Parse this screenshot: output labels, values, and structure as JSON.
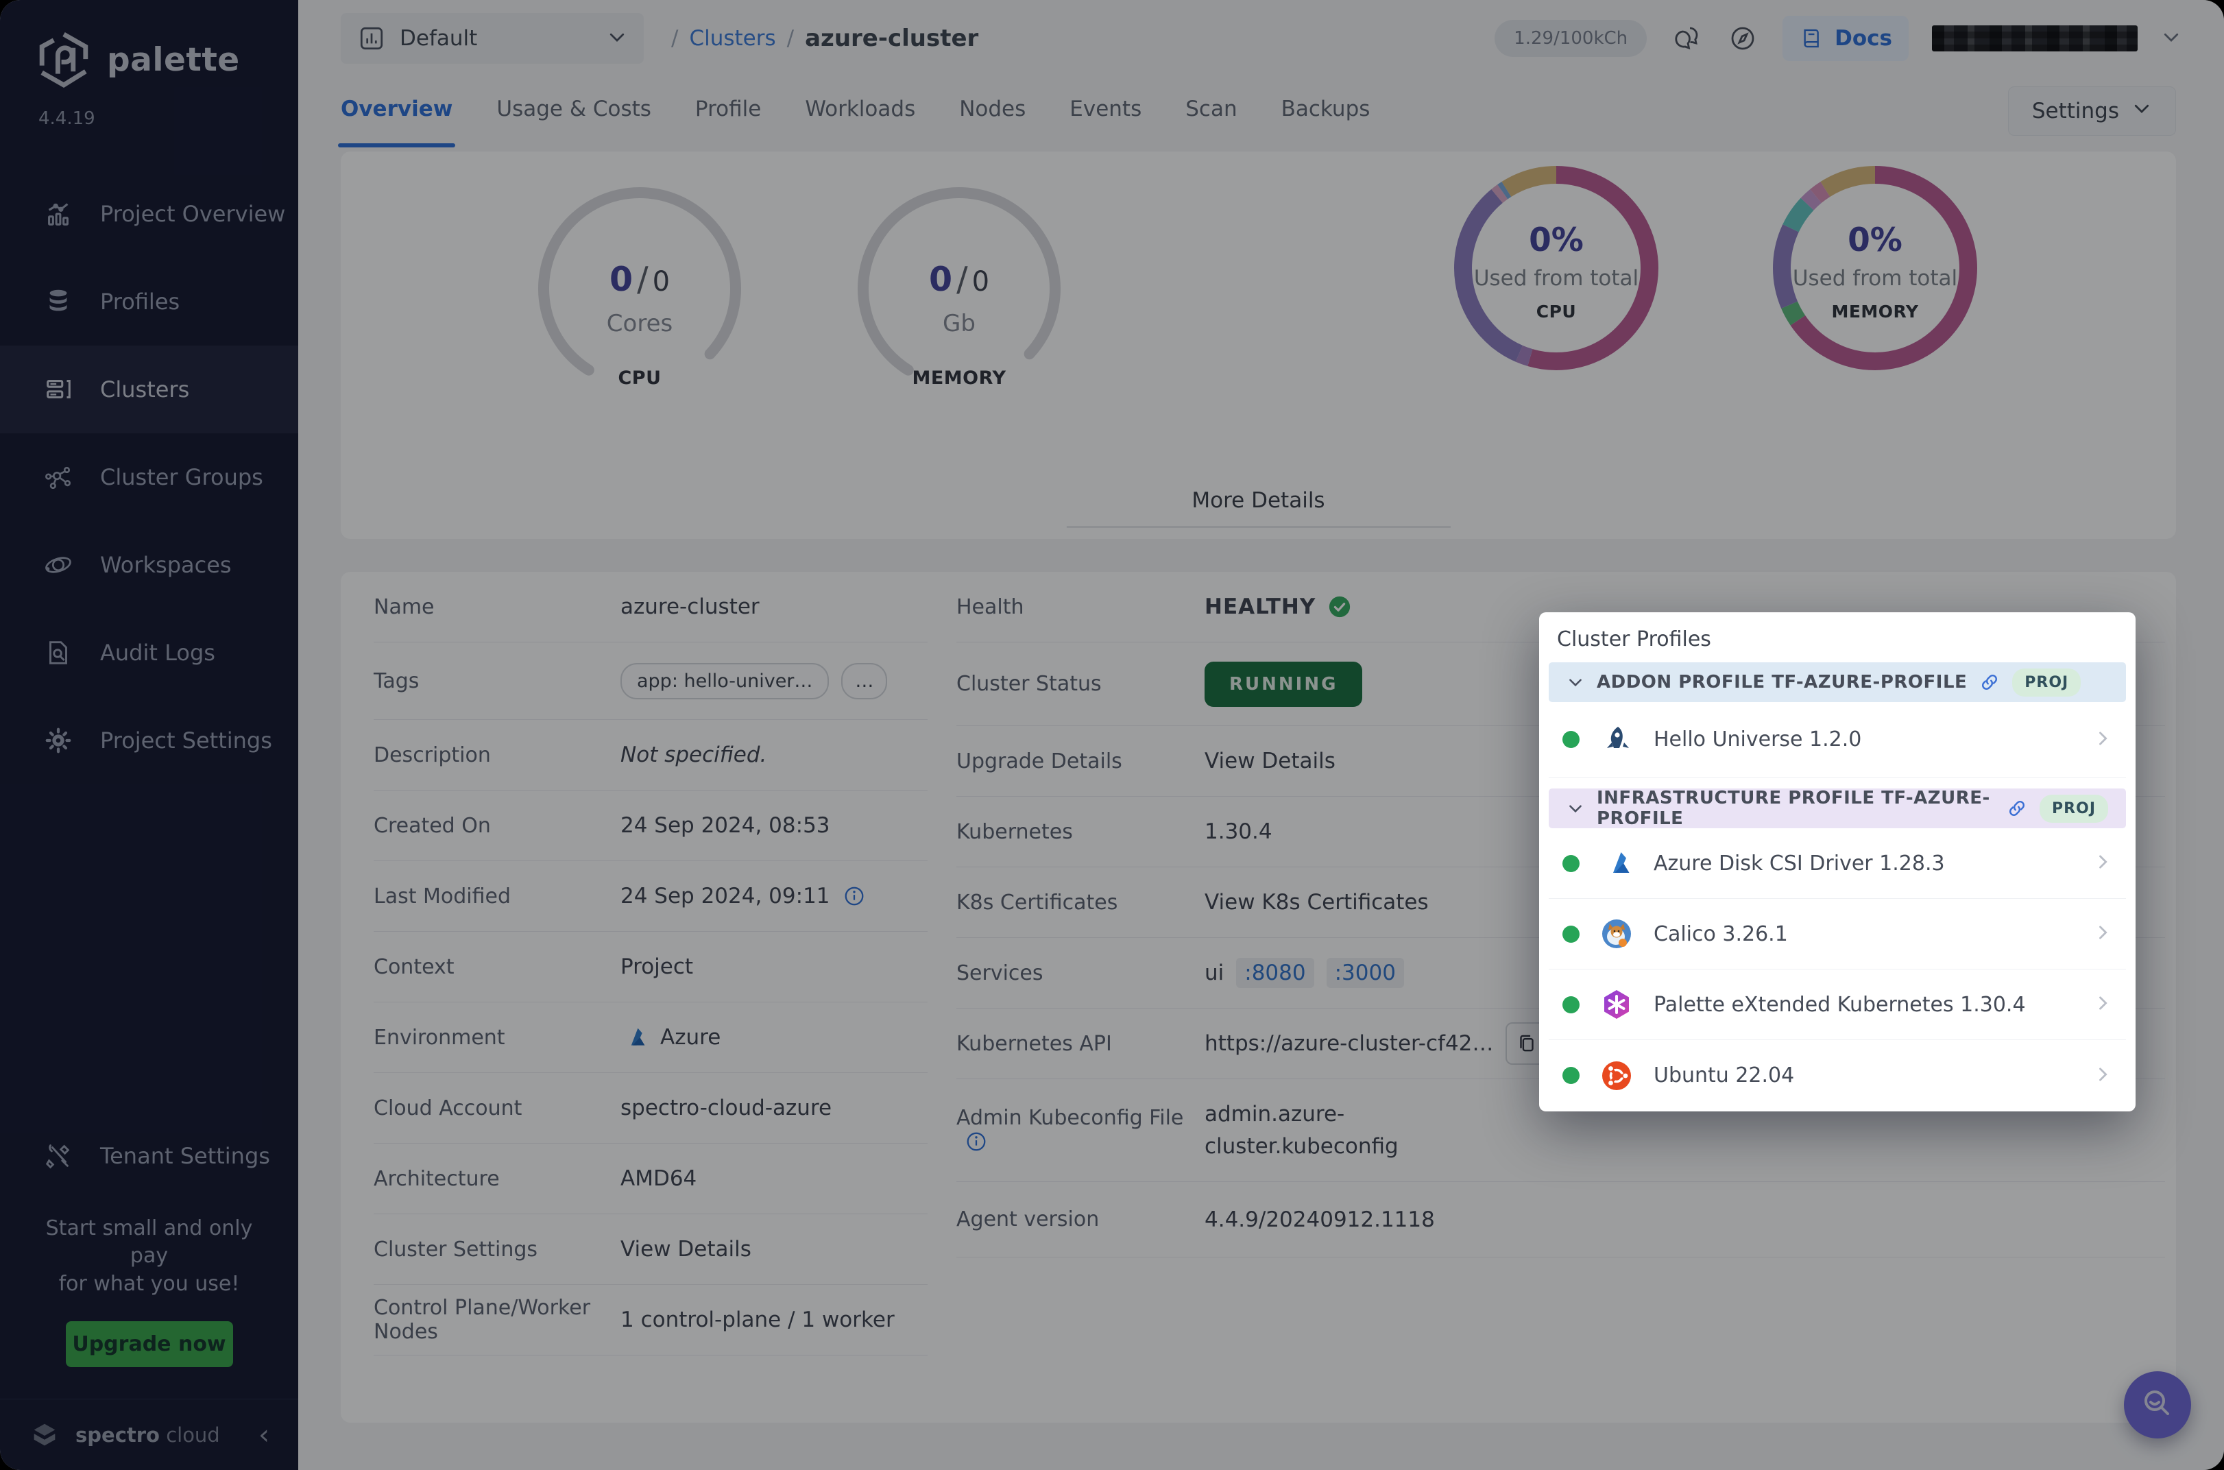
{
  "colors": {
    "accent_blue": "#3c7ad6",
    "active_tab_blue": "#2d6fd6",
    "healthy_green": "#2c9e57",
    "running_badge_green": "#1a6f40",
    "upgrade_button_green": "#38a34a",
    "metric_indigo": "#43439a",
    "sidebar_bg": "#141830",
    "fab_purple": "#6e68d8",
    "donut_pink": "#b85a92",
    "donut_purple": "#8a7cbe",
    "donut_gold": "#d8b77c",
    "donut_teal": "#63c4c0",
    "donut_green": "#5cb87c"
  },
  "sidebar": {
    "brand": "palette",
    "version": "4.4.19",
    "items": [
      {
        "label": "Project Overview",
        "icon": "chart-icon",
        "active": false
      },
      {
        "label": "Profiles",
        "icon": "layers-icon",
        "active": false
      },
      {
        "label": "Clusters",
        "icon": "servers-icon",
        "active": true
      },
      {
        "label": "Cluster Groups",
        "icon": "network-icon",
        "active": false
      },
      {
        "label": "Workspaces",
        "icon": "orbit-icon",
        "active": false
      },
      {
        "label": "Audit Logs",
        "icon": "doc-search-icon",
        "active": false
      },
      {
        "label": "Project Settings",
        "icon": "gear-icon",
        "active": false
      }
    ],
    "tenant_settings": "Tenant Settings",
    "promo": {
      "line1": "Start small and only pay",
      "line2": "for what you use!",
      "button": "Upgrade now"
    },
    "footer": {
      "brand_bold": "spectro",
      "brand_light": "cloud"
    }
  },
  "topbar": {
    "project_selector": "Default",
    "breadcrumb": {
      "link": "Clusters",
      "current": "azure-cluster"
    },
    "usage_pill": "1.29/100kCh",
    "docs_label": "Docs"
  },
  "tabs": {
    "items": [
      "Overview",
      "Usage & Costs",
      "Profile",
      "Workloads",
      "Nodes",
      "Events",
      "Scan",
      "Backups"
    ],
    "active": "Overview",
    "settings_button": "Settings"
  },
  "metrics": {
    "gauges": [
      {
        "used": "0",
        "total": "0",
        "unit": "Cores",
        "caption": "CPU"
      },
      {
        "used": "0",
        "total": "0",
        "unit": "Gb",
        "caption": "MEMORY"
      }
    ],
    "donuts": [
      {
        "percent": "0%",
        "label": "Used from total",
        "caption": "CPU",
        "segments": [
          {
            "c": "#b85a92",
            "f": 0.545
          },
          {
            "c": "#a583c2",
            "f": 0.02
          },
          {
            "c": "#8a7cbe",
            "f": 0.325
          },
          {
            "c": "#d9a7c6",
            "f": 0.012
          },
          {
            "c": "#7aa7d9",
            "f": 0.008
          },
          {
            "c": "#d8b77c",
            "f": 0.09
          }
        ]
      },
      {
        "percent": "0%",
        "label": "Used from total",
        "caption": "MEMORY",
        "segments": [
          {
            "c": "#b85a92",
            "f": 0.655
          },
          {
            "c": "#5cb87c",
            "f": 0.03
          },
          {
            "c": "#8a7cbe",
            "f": 0.135
          },
          {
            "c": "#63c4c0",
            "f": 0.05
          },
          {
            "c": "#c79ad1",
            "f": 0.02
          },
          {
            "c": "#d88fb8",
            "f": 0.02
          },
          {
            "c": "#d8b77c",
            "f": 0.09
          }
        ]
      }
    ],
    "more_details": "More Details"
  },
  "details_left": {
    "rows": [
      {
        "label": "Name",
        "value": "azure-cluster"
      },
      {
        "label": "Tags",
        "chips": [
          "app: hello-univer…",
          "…"
        ]
      },
      {
        "label": "Description",
        "value": "Not specified."
      },
      {
        "label": "Created On",
        "value": "24 Sep 2024, 08:53"
      },
      {
        "label": "Last Modified",
        "value": "24 Sep 2024, 09:11"
      },
      {
        "label": "Context",
        "value": "Project"
      },
      {
        "label": "Environment",
        "value": "Azure"
      },
      {
        "label": "Cloud Account",
        "value": "spectro-cloud-azure"
      },
      {
        "label": "Architecture",
        "value": "AMD64"
      },
      {
        "label": "Cluster Settings",
        "link": "View Details"
      },
      {
        "label": "Control Plane/Worker Nodes",
        "value": "1 control-plane / 1 worker"
      }
    ]
  },
  "details_right": {
    "rows": [
      {
        "label": "Health",
        "status": "HEALTHY"
      },
      {
        "label": "Cluster Status",
        "badge": "RUNNING"
      },
      {
        "label": "Upgrade Details",
        "link": "View Details"
      },
      {
        "label": "Kubernetes",
        "value": "1.30.4"
      },
      {
        "label": "K8s Certificates",
        "link": "View K8s Certificates"
      },
      {
        "label": "Services",
        "prefix": "ui",
        "port1": ":8080",
        "port2": ":3000"
      },
      {
        "label": "Kubernetes API",
        "value": "https://azure-cluster-cf42…"
      },
      {
        "label": "Admin Kubeconfig File",
        "link": "admin.azure-cluster.kubeconfig"
      },
      {
        "label": "Agent version",
        "value": "4.4.9/20240912.1118"
      }
    ]
  },
  "popup": {
    "title": "Cluster Profiles",
    "groups": [
      {
        "header": "ADDON PROFILE TF-AZURE-PROFILE",
        "badge": "PROJ",
        "items": [
          {
            "name": "Hello Universe 1.2.0",
            "icon": "rocket-icon"
          }
        ]
      },
      {
        "header": "INFRASTRUCTURE PROFILE TF-AZURE-PROFILE",
        "badge": "PROJ",
        "items": [
          {
            "name": "Azure Disk CSI Driver 1.28.3",
            "icon": "azure-icon"
          },
          {
            "name": "Calico 3.26.1",
            "icon": "calico-icon"
          },
          {
            "name": "Palette eXtended Kubernetes 1.30.4",
            "icon": "pxk-icon"
          },
          {
            "name": "Ubuntu 22.04",
            "icon": "ubuntu-icon"
          }
        ]
      }
    ]
  }
}
